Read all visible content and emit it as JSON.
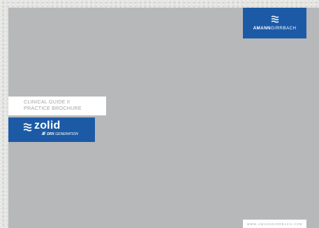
{
  "brand": {
    "name_bold": "AMANN",
    "name_light": "GIRRBACH",
    "logo_icon": "three-waves-icon",
    "color": "#1c5aa6"
  },
  "guide": {
    "line1": "CLINICAL GUIDE II",
    "line2": "PRACTICE BROCHURE"
  },
  "product": {
    "name": "zolid",
    "logo_icon": "three-waves-icon",
    "slashes": "////",
    "gen_bold": "DRX",
    "gen_light": " GENERATION"
  },
  "footer": {
    "url": "WWW.AMANNGIRRBACH.COM"
  }
}
